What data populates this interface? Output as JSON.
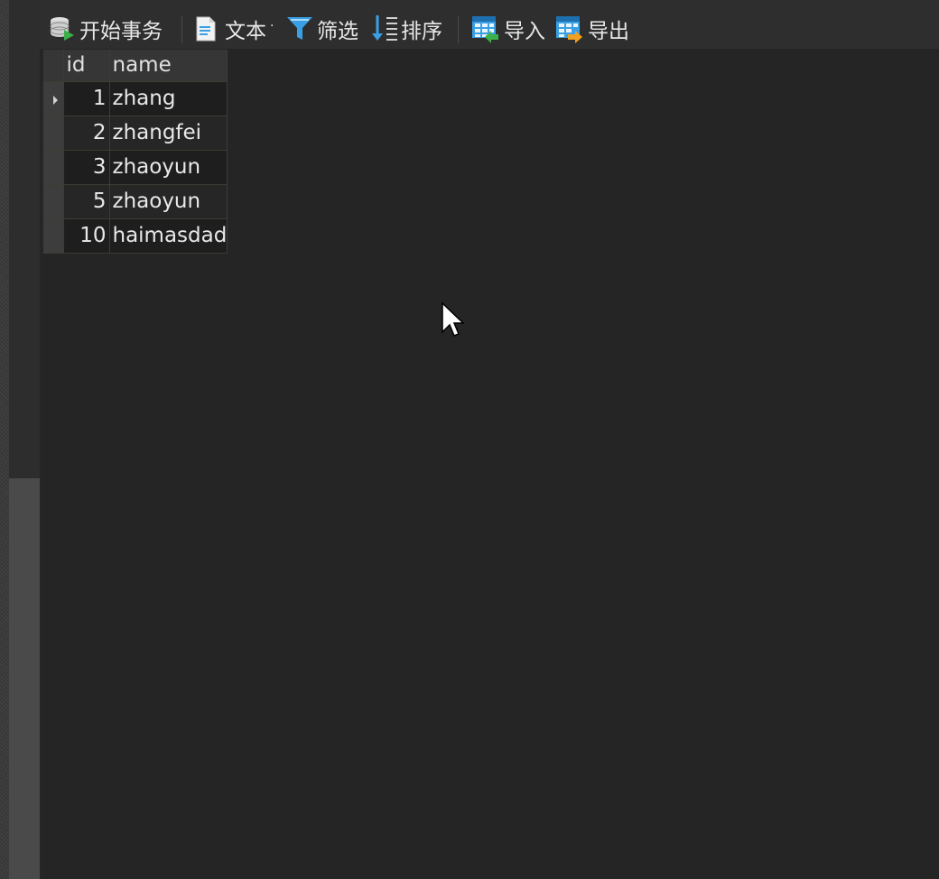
{
  "toolbar": {
    "begin_transaction": "开始事务",
    "text": "文本",
    "text_dropdown": "·",
    "filter": "筛选",
    "sort": "排序",
    "import": "导入",
    "export": "导出"
  },
  "grid": {
    "columns": [
      "id",
      "name"
    ],
    "rows": [
      {
        "id": "1",
        "name": "zhang"
      },
      {
        "id": "2",
        "name": "zhangfei"
      },
      {
        "id": "3",
        "name": "zhaoyun"
      },
      {
        "id": "5",
        "name": "zhaoyun"
      },
      {
        "id": "10",
        "name": "haimasdad"
      }
    ],
    "current_row_marker": "row-pointer-icon"
  },
  "colors": {
    "background": "#262626",
    "toolbar": "#2e2e2e",
    "icon_blue": "#3aa0e6",
    "icon_green": "#3cb04a",
    "icon_orange": "#f0a020"
  }
}
